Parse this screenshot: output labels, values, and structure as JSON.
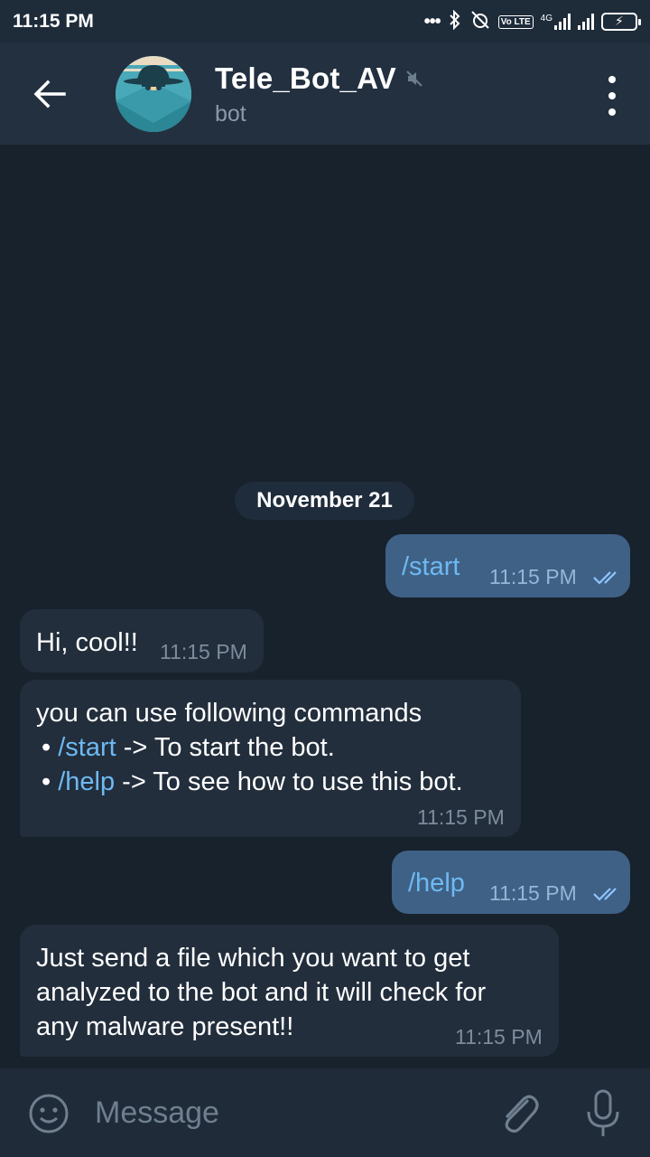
{
  "status_bar": {
    "time": "11:15 PM",
    "icons": [
      "more-dots-icon",
      "bluetooth-icon",
      "alarm-off-icon",
      "volte-icon",
      "signal-4g-icon",
      "signal-icon",
      "battery-charging-icon"
    ],
    "network_label": "4G",
    "volte_label": "Vo LTE"
  },
  "header": {
    "title": "Tele_Bot_AV",
    "subtitle": "bot",
    "muted": true
  },
  "chat": {
    "date_label": "November 21",
    "messages": [
      {
        "direction": "out",
        "text": "/start",
        "time": "11:15 PM",
        "read": true
      },
      {
        "direction": "in",
        "text": "Hi, cool!!",
        "time": "11:15 PM"
      },
      {
        "direction": "in",
        "intro": "you can use following commands",
        "items": [
          {
            "bullet": "•",
            "command": "/start",
            "rest": " -> To start the bot."
          },
          {
            "bullet": "•",
            "command": "/help",
            "rest": " -> To see how to use this bot."
          }
        ],
        "time": "11:15 PM"
      },
      {
        "direction": "out",
        "text": "/help",
        "time": "11:15 PM",
        "read": true
      },
      {
        "direction": "in",
        "lines": [
          "Just send a file which you want to get",
          "analyzed to the bot and it will check for",
          "any malware present!!"
        ],
        "time": "11:15 PM"
      }
    ]
  },
  "input": {
    "placeholder": "Message"
  },
  "colors": {
    "background": "#18222d",
    "header": "#233040",
    "outgoing_bubble": "#3f6186",
    "incoming_bubble": "#222e3c",
    "command_link": "#6eb9f2"
  }
}
